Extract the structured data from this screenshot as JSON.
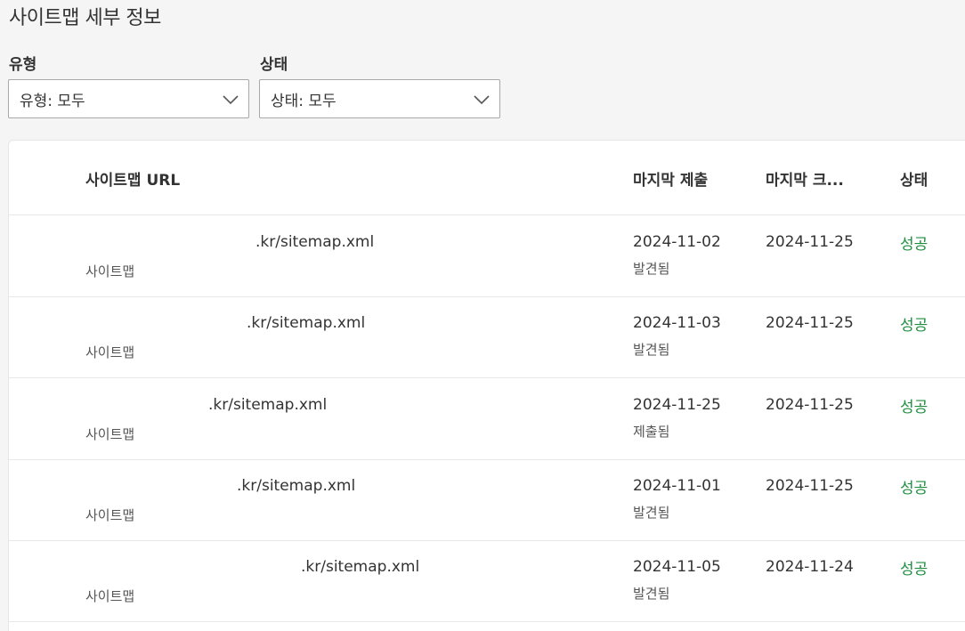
{
  "page": {
    "title": "사이트맵 세부 정보"
  },
  "filters": {
    "type": {
      "label": "유형",
      "value": "유형: 모두"
    },
    "status": {
      "label": "상태",
      "value": "상태: 모두"
    }
  },
  "table": {
    "headers": {
      "url": "사이트맵 URL",
      "last_submitted": "마지막 제출",
      "last_crawled": "마지막 크...",
      "status": "상태"
    },
    "rows": [
      {
        "url": ".kr/sitemap.xml",
        "type": "사이트맵",
        "last_submitted": "2024-11-02",
        "submit_note": "발견됨",
        "last_crawled": "2024-11-25",
        "status": "성공"
      },
      {
        "url": ".kr/sitemap.xml",
        "type": "사이트맵",
        "last_submitted": "2024-11-03",
        "submit_note": "발견됨",
        "last_crawled": "2024-11-25",
        "status": "성공"
      },
      {
        "url": ".kr/sitemap.xml",
        "type": "사이트맵",
        "last_submitted": "2024-11-25",
        "submit_note": "제출됨",
        "last_crawled": "2024-11-25",
        "status": "성공"
      },
      {
        "url": ".kr/sitemap.xml",
        "type": "사이트맵",
        "last_submitted": "2024-11-01",
        "submit_note": "발견됨",
        "last_crawled": "2024-11-25",
        "status": "성공"
      },
      {
        "url": ".kr/sitemap.xml",
        "type": "사이트맵",
        "last_submitted": "2024-11-05",
        "submit_note": "발견됨",
        "last_crawled": "2024-11-24",
        "status": "성공"
      }
    ]
  },
  "colors": {
    "success": "#1e8e3e",
    "background": "#f5f5f5"
  },
  "icons": {
    "dropdown": "chevron-down-icon"
  }
}
